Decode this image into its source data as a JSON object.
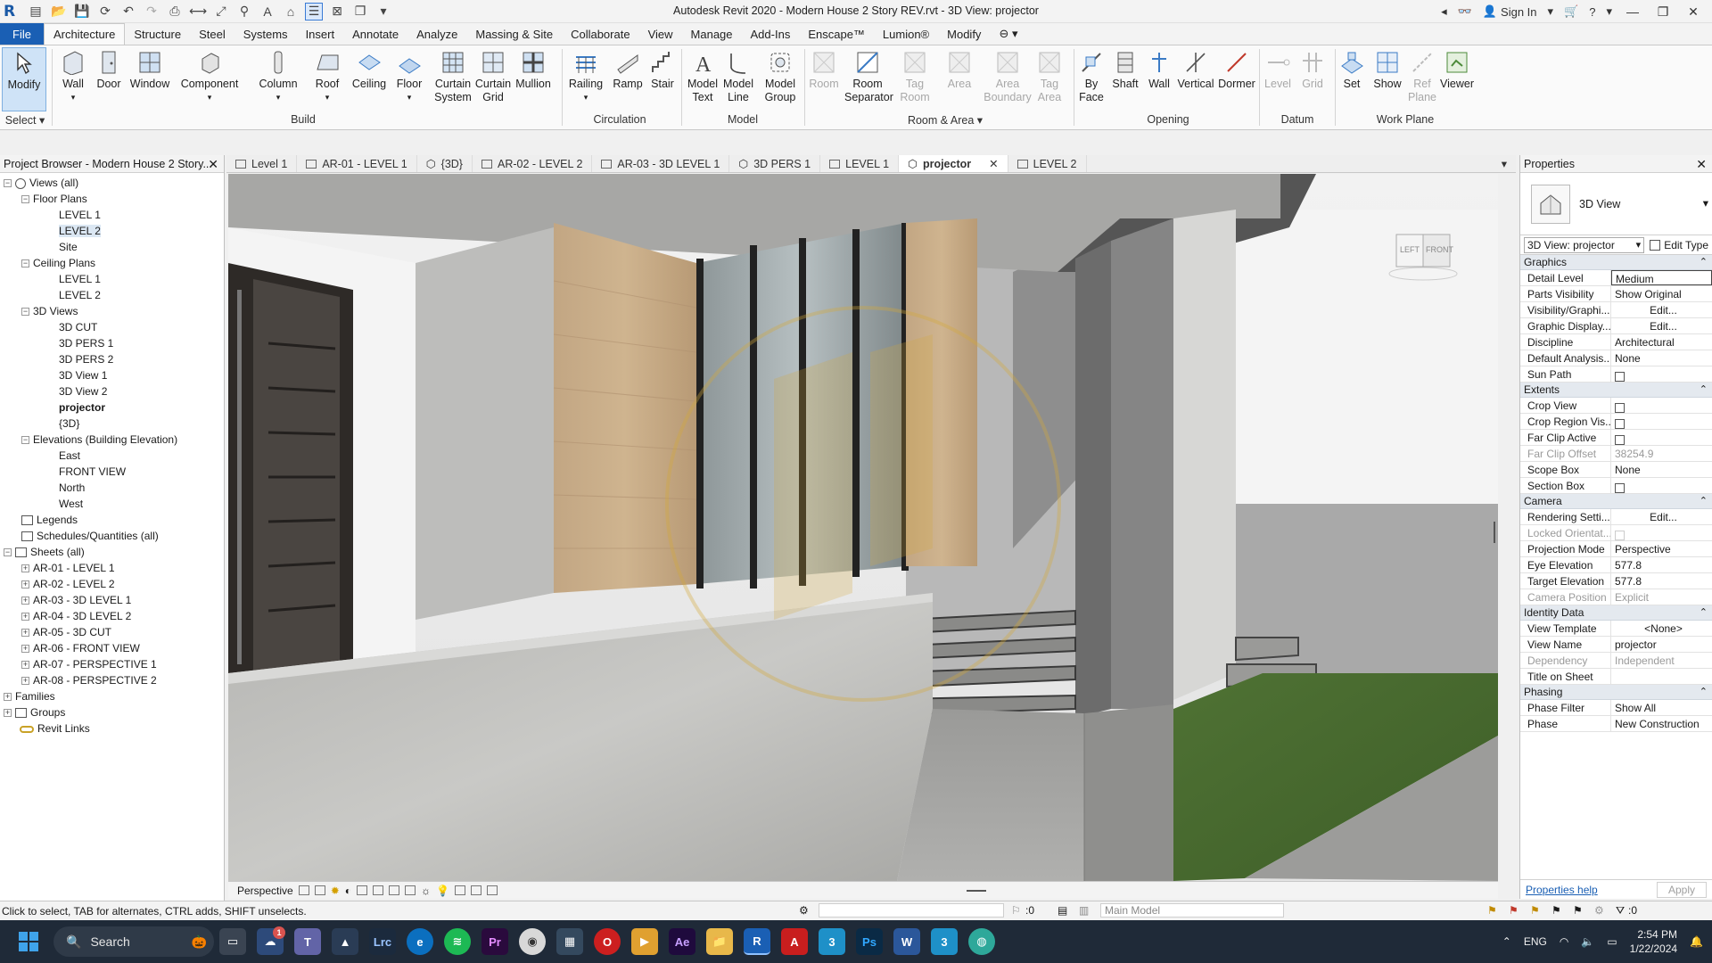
{
  "window": {
    "title": "Autodesk Revit 2020 - Modern House 2 Story REV.rvt - 3D View: projector",
    "sign_in": "Sign In"
  },
  "ribbon_tabs": [
    "File",
    "Architecture",
    "Structure",
    "Steel",
    "Systems",
    "Insert",
    "Annotate",
    "Analyze",
    "Massing & Site",
    "Collaborate",
    "View",
    "Manage",
    "Add-Ins",
    "Enscape™",
    "Lumion®",
    "Modify"
  ],
  "ribbon": {
    "select": {
      "modify": "Modify",
      "panel": "Select"
    },
    "build": {
      "wall": "Wall",
      "door": "Door",
      "window": "Window",
      "component": "Component",
      "column": "Column",
      "roof": "Roof",
      "ceiling": "Ceiling",
      "floor": "Floor",
      "curtain_system_1": "Curtain",
      "curtain_system_2": "System",
      "curtain_grid_1": "Curtain",
      "curtain_grid_2": "Grid",
      "mullion": "Mullion",
      "panel": "Build"
    },
    "circulation": {
      "railing": "Railing",
      "ramp": "Ramp",
      "stair": "Stair",
      "panel": "Circulation"
    },
    "model": {
      "model_text_1": "Model",
      "model_text_2": "Text",
      "model_line_1": "Model",
      "model_line_2": "Line",
      "model_group_1": "Model",
      "model_group_2": "Group",
      "panel": "Model"
    },
    "room_area": {
      "room": "Room",
      "room_separator_1": "Room",
      "room_separator_2": "Separator",
      "tag_room_1": "Tag",
      "tag_room_2": "Room",
      "area": "Area",
      "area_boundary_1": "Area",
      "area_boundary_2": "Boundary",
      "tag_area_1": "Tag",
      "tag_area_2": "Area",
      "panel": "Room & Area"
    },
    "opening": {
      "by_face_1": "By",
      "by_face_2": "Face",
      "shaft": "Shaft",
      "wall": "Wall",
      "vertical": "Vertical",
      "dormer": "Dormer",
      "panel": "Opening"
    },
    "datum": {
      "level": "Level",
      "grid": "Grid",
      "panel": "Datum"
    },
    "work_plane": {
      "set": "Set",
      "show": "Show",
      "ref_plane_1": "Ref",
      "ref_plane_2": "Plane",
      "viewer": "Viewer",
      "panel": "Work Plane"
    }
  },
  "project_browser": {
    "title": "Project Browser - Modern House 2 Story...",
    "nodes": [
      {
        "label": "Views (all)"
      },
      {
        "label": "Floor Plans"
      },
      {
        "label": "LEVEL 1"
      },
      {
        "label": "LEVEL 2"
      },
      {
        "label": "Site"
      },
      {
        "label": "Ceiling Plans"
      },
      {
        "label": "LEVEL 1"
      },
      {
        "label": "LEVEL 2"
      },
      {
        "label": "3D Views"
      },
      {
        "label": "3D CUT"
      },
      {
        "label": "3D PERS 1"
      },
      {
        "label": "3D PERS 2"
      },
      {
        "label": "3D View 1"
      },
      {
        "label": "3D View 2"
      },
      {
        "label": "projector"
      },
      {
        "label": "{3D}"
      },
      {
        "label": "Elevations (Building Elevation)"
      },
      {
        "label": "East"
      },
      {
        "label": "FRONT VIEW"
      },
      {
        "label": "North"
      },
      {
        "label": "West"
      },
      {
        "label": "Legends"
      },
      {
        "label": "Schedules/Quantities (all)"
      },
      {
        "label": "Sheets (all)"
      },
      {
        "label": "AR-01 - LEVEL 1"
      },
      {
        "label": "AR-02 - LEVEL 2"
      },
      {
        "label": "AR-03 - 3D LEVEL 1"
      },
      {
        "label": "AR-04 - 3D LEVEL 2"
      },
      {
        "label": "AR-05 - 3D CUT"
      },
      {
        "label": "AR-06 - FRONT VIEW"
      },
      {
        "label": "AR-07 - PERSPECTIVE 1"
      },
      {
        "label": "AR-08 - PERSPECTIVE 2"
      },
      {
        "label": "Families"
      },
      {
        "label": "Groups"
      },
      {
        "label": "Revit Links"
      }
    ]
  },
  "view_tabs": [
    "Level 1",
    "AR-01 - LEVEL 1",
    "{3D}",
    "AR-02 - LEVEL 2",
    "AR-03 - 3D LEVEL 1",
    "3D PERS 1",
    "LEVEL 1",
    "projector",
    "LEVEL 2"
  ],
  "viewcube": {
    "left": "LEFT",
    "front": "FRONT"
  },
  "view_control": {
    "mode": "Perspective"
  },
  "properties": {
    "title": "Properties",
    "type_name": "3D View",
    "instance": "3D View: projector",
    "edit_type": "Edit Type",
    "groups": [
      {
        "name": "Graphics",
        "rows": [
          {
            "k": "Detail Level",
            "v": "Medium"
          },
          {
            "k": "Parts Visibility",
            "v": "Show Original"
          },
          {
            "k": "Visibility/Graphi...",
            "v": "Edit..."
          },
          {
            "k": "Graphic Display...",
            "v": "Edit..."
          },
          {
            "k": "Discipline",
            "v": "Architectural"
          },
          {
            "k": "Default Analysis...",
            "v": "None"
          },
          {
            "k": "Sun Path",
            "v": ""
          }
        ]
      },
      {
        "name": "Extents",
        "rows": [
          {
            "k": "Crop View",
            "v": ""
          },
          {
            "k": "Crop Region Vis...",
            "v": ""
          },
          {
            "k": "Far Clip Active",
            "v": ""
          },
          {
            "k": "Far Clip Offset",
            "v": "38254.9"
          },
          {
            "k": "Scope Box",
            "v": "None"
          },
          {
            "k": "Section Box",
            "v": ""
          }
        ]
      },
      {
        "name": "Camera",
        "rows": [
          {
            "k": "Rendering Setti...",
            "v": "Edit..."
          },
          {
            "k": "Locked Orientat...",
            "v": ""
          },
          {
            "k": "Projection Mode",
            "v": "Perspective"
          },
          {
            "k": "Eye Elevation",
            "v": "577.8"
          },
          {
            "k": "Target Elevation",
            "v": "577.8"
          },
          {
            "k": "Camera Position",
            "v": "Explicit"
          }
        ]
      },
      {
        "name": "Identity Data",
        "rows": [
          {
            "k": "View Template",
            "v": "<None>"
          },
          {
            "k": "View Name",
            "v": "projector"
          },
          {
            "k": "Dependency",
            "v": "Independent"
          },
          {
            "k": "Title on Sheet",
            "v": ""
          }
        ]
      },
      {
        "name": "Phasing",
        "rows": [
          {
            "k": "Phase Filter",
            "v": "Show All"
          },
          {
            "k": "Phase",
            "v": "New Construction"
          }
        ]
      }
    ],
    "help": "Properties help",
    "apply": "Apply"
  },
  "status": {
    "message": "Click to select, TAB for alternates, CTRL adds, SHIFT unselects.",
    "worksets": ":0",
    "model": "Main Model",
    "filter": ":0"
  },
  "taskbar": {
    "search": "Search",
    "lang": "ENG",
    "time": "2:54 PM",
    "date": "1/22/2024",
    "badge": "1"
  }
}
